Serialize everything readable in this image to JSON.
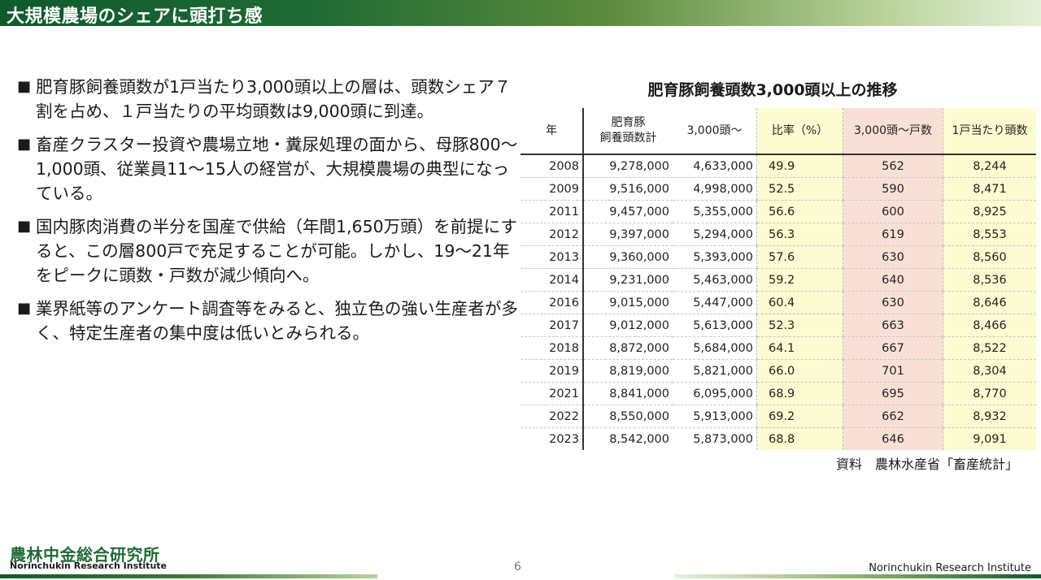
{
  "header": {
    "title": "大規模農場のシェアに頭打ち感"
  },
  "bullets": [
    {
      "mark": "■",
      "text": "肥育豚飼養頭数が1戸当たり3,000頭以上の層は、頭数シェア７割を占め、１戸当たりの平均頭数は9,000頭に到達。"
    },
    {
      "mark": "■",
      "text": "畜産クラスター投資や農場立地・糞尿処理の面から、母豚800～1,000頭、従業員11～15人の経営が、大規模農場の典型になっている。"
    },
    {
      "mark": "■",
      "text": "国内豚肉消費の半分を国産で供給（年間1,650万頭）を前提にすると、この層800戸で充足することが可能。しかし、19～21年をピークに頭数・戸数が減少傾向へ。"
    },
    {
      "mark": "■",
      "text": "業界紙等のアンケート調査等をみると、独立色の強い生産者が多く、特定生産者の集中度は低いとみられる。"
    }
  ],
  "table": {
    "title": "肥育豚飼養頭数3,000頭以上の推移",
    "headers": {
      "year": "年",
      "total_line1": "肥育豚",
      "total_line2": "飼養頭数計",
      "over3000": "3,000頭～",
      "ratio": "比率（%）",
      "houses": "3,000頭～戸数",
      "per_house": "1戸当たり頭数"
    },
    "rows": [
      [
        "2008",
        "9,278,000",
        "4,633,000",
        "49.9",
        "562",
        "8,244"
      ],
      [
        "2009",
        "9,516,000",
        "4,998,000",
        "52.5",
        "590",
        "8,471"
      ],
      [
        "2011",
        "9,457,000",
        "5,355,000",
        "56.6",
        "600",
        "8,925"
      ],
      [
        "2012",
        "9,397,000",
        "5,294,000",
        "56.3",
        "619",
        "8,553"
      ],
      [
        "2013",
        "9,360,000",
        "5,393,000",
        "57.6",
        "630",
        "8,560"
      ],
      [
        "2014",
        "9,231,000",
        "5,463,000",
        "59.2",
        "640",
        "8,536"
      ],
      [
        "2016",
        "9,015,000",
        "5,447,000",
        "60.4",
        "630",
        "8,646"
      ],
      [
        "2017",
        "9,012,000",
        "5,613,000",
        "52.3",
        "663",
        "8,466"
      ],
      [
        "2018",
        "8,872,000",
        "5,684,000",
        "64.1",
        "667",
        "8,522"
      ],
      [
        "2019",
        "8,819,000",
        "5,821,000",
        "66.0",
        "701",
        "8,304"
      ],
      [
        "2021",
        "8,841,000",
        "6,095,000",
        "68.9",
        "695",
        "8,770"
      ],
      [
        "2022",
        "8,550,000",
        "5,913,000",
        "69.2",
        "662",
        "8,932"
      ],
      [
        "2023",
        "8,542,000",
        "5,873,000",
        "68.8",
        "646",
        "9,091"
      ]
    ],
    "source": "資料　農林水産省「畜産統計」"
  },
  "footer": {
    "logo_jp": "農林中金総合研究所",
    "logo_en": "Norinchukin Research Institute",
    "page_number": "6",
    "org_name": "Norinchukin Research Institute"
  },
  "colors": {
    "title_green": "#0f5a2b",
    "ratio_column": "#fdfbd0",
    "houses_column": "#f9e0d6"
  }
}
